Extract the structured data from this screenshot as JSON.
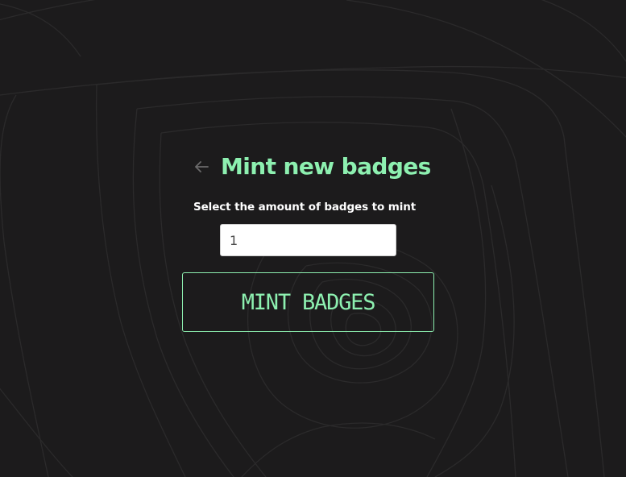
{
  "page": {
    "title": "Mint new badges",
    "back_icon": "arrow-left-icon"
  },
  "form": {
    "amount_label": "Select the amount of badges to mint",
    "amount_value": "1",
    "submit_label": "MINT BADGES"
  },
  "colors": {
    "background": "#1c1b1c",
    "accent": "#8df0b0",
    "label_text": "#ffffff",
    "input_background": "#ffffff",
    "back_icon": "#6b6b6b"
  }
}
